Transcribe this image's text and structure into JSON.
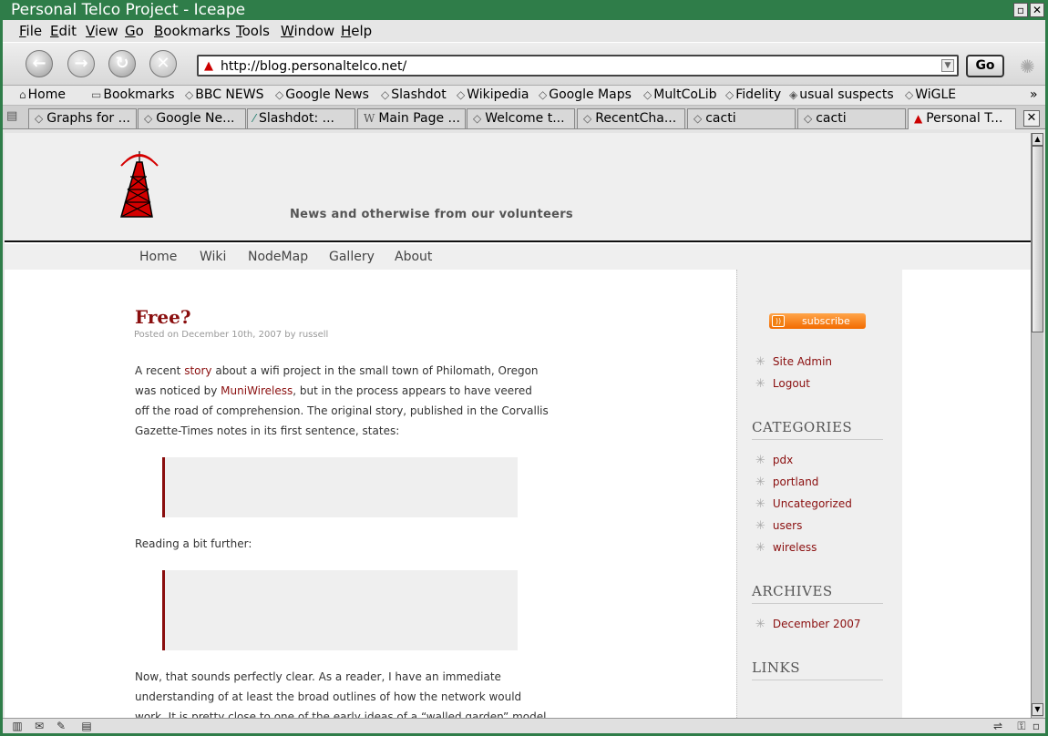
{
  "window": {
    "title": "Personal Telco Project - Iceape"
  },
  "menu": [
    "File",
    "Edit",
    "View",
    "Go",
    "Bookmarks",
    "Tools",
    "Window",
    "Help"
  ],
  "toolbar": {
    "url": "http://blog.personaltelco.net/",
    "go_label": "Go"
  },
  "bookmarks": [
    "Home",
    "Bookmarks",
    "BBC NEWS",
    "Google News",
    "Slashdot",
    "Wikipedia",
    "Google Maps",
    "MultCoLib",
    "Fidelity",
    "usual suspects",
    "WiGLE"
  ],
  "tabs": [
    "Graphs for ...",
    "Google Ne...",
    "Slashdot: ...",
    "Main Page ...",
    "Welcome t...",
    "RecentCha...",
    "cacti",
    "cacti",
    "Personal T..."
  ],
  "site": {
    "tagline": "News and otherwise from our volunteers",
    "nav": [
      "Home",
      "Wiki",
      "NodeMap",
      "Gallery",
      "About"
    ]
  },
  "post": {
    "title": "Free?",
    "meta_prefix": "Posted on",
    "date": "December 10th, 2007",
    "meta_by": "by",
    "author": "russell",
    "p1_a": "A recent ",
    "p1_link1": "story",
    "p1_b": " about a wifi project in the small town of Philomath, Oregon was noticed by ",
    "p1_link2": "MuniWireless",
    "p1_c": ", but in the process appears to have veered off the road of comprehension. The original story, published in the Corvallis Gazette-Times notes in its first sentence, states:",
    "p2": "Reading a bit further:",
    "p3": "Now, that sounds perfectly clear. As a reader, I have an immediate understanding of at least the broad outlines of how the network would work. It is pretty close to one of the early ideas of a “walled garden” model for the"
  },
  "sidebar": {
    "subscribe": "subscribe",
    "admin_links": [
      "Site Admin",
      "Logout"
    ],
    "categories_title": "CATEGORIES",
    "categories": [
      "pdx",
      "portland",
      "Uncategorized",
      "users",
      "wireless"
    ],
    "archives_title": "ARCHIVES",
    "archives": [
      "December 2007"
    ],
    "links_title": "LINKS"
  },
  "colors": {
    "accent": "#8a0e0e",
    "titlebar": "#2f7d49"
  }
}
